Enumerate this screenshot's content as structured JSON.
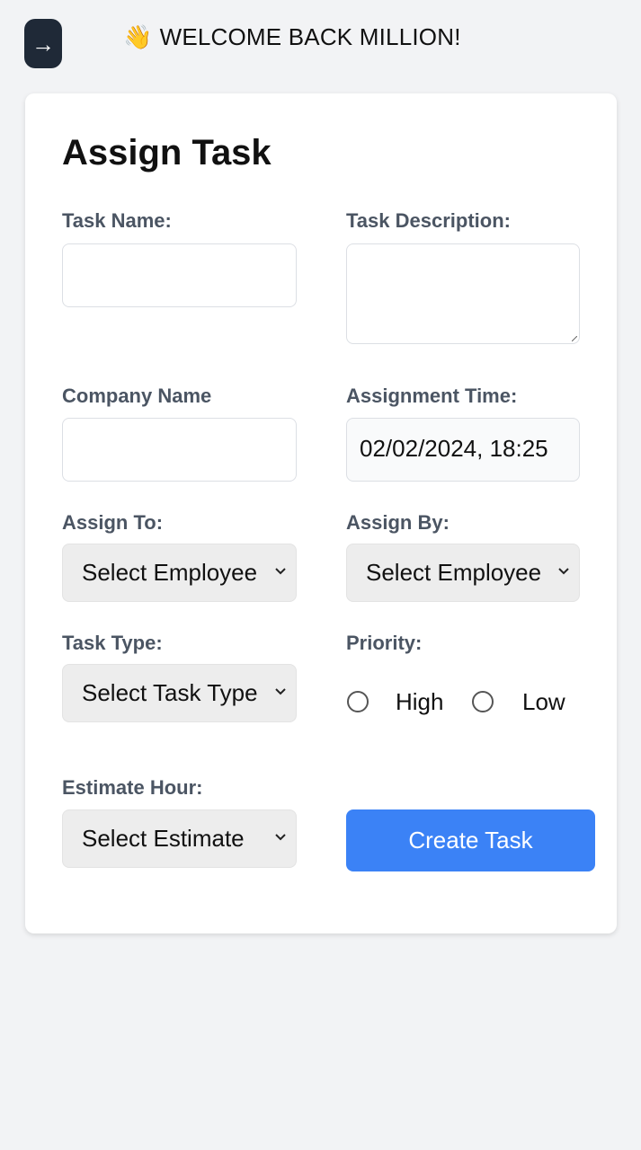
{
  "header": {
    "back_icon": "→",
    "wave_emoji": "👋",
    "welcome_text": "WELCOME BACK MILLION!"
  },
  "form": {
    "title": "Assign Task",
    "task_name": {
      "label": "Task Name:",
      "value": ""
    },
    "task_description": {
      "label": "Task Description:",
      "value": ""
    },
    "company_name": {
      "label": "Company Name",
      "value": ""
    },
    "assignment_time": {
      "label": "Assignment Time:",
      "value": "02/02/2024, 18:25"
    },
    "assign_to": {
      "label": "Assign To:",
      "selected": "Select Employee"
    },
    "assign_by": {
      "label": "Assign By:",
      "selected": "Select Employee"
    },
    "task_type": {
      "label": "Task Type:",
      "selected": "Select Task Type"
    },
    "priority": {
      "label": "Priority:",
      "options": [
        "High",
        "Low"
      ]
    },
    "estimate_hour": {
      "label": "Estimate Hour:",
      "selected": "Select Estimate"
    },
    "create_button": "Create Task"
  },
  "colors": {
    "primary_button": "#3b82f6",
    "back_button": "#1f2937",
    "page_background": "#f2f3f5"
  }
}
